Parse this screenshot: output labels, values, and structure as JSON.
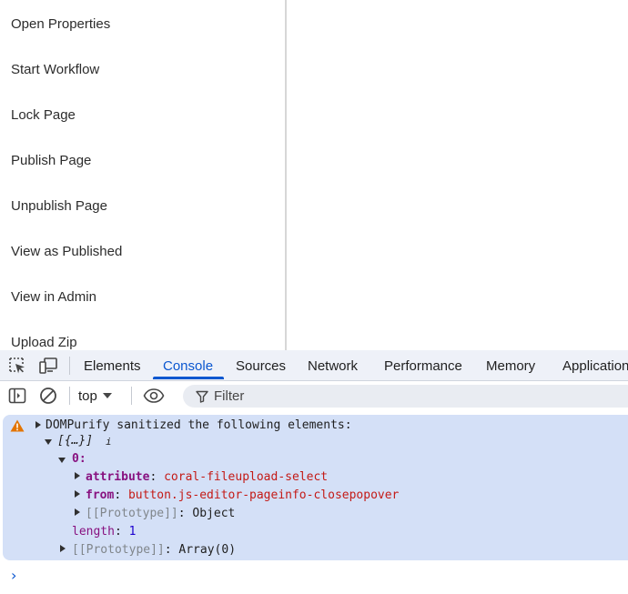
{
  "menu": {
    "items": [
      "Open Properties",
      "Start Workflow",
      "Lock Page",
      "Publish Page",
      "Unpublish Page",
      "View as Published",
      "View in Admin",
      "Upload Zip"
    ]
  },
  "devtools": {
    "tabs": [
      "Elements",
      "Console",
      "Sources",
      "Network",
      "Performance",
      "Memory",
      "Application"
    ],
    "active_tab": "Console",
    "toolbar": {
      "context": "top",
      "filter_placeholder": "Filter"
    },
    "console": {
      "warning_message": "DOMPurify sanitized the following elements:",
      "array_summary": "[{…}]",
      "info_marker": "i",
      "item_index": "0:",
      "attribute_key": "attribute",
      "attribute_value": "coral-fileupload-select",
      "from_key": "from",
      "from_value": "button.js-editor-pageinfo-closepopover",
      "proto_key": "[[Prototype]]",
      "proto_object_value": "Object",
      "length_key": "length",
      "length_value": "1",
      "proto_array_value": "Array(0)",
      "colon": ":",
      "prompt": "›"
    },
    "colors": {
      "accent": "#0b57d0",
      "warning_bg": "#d4e0f7",
      "warning_icon": "#e37400"
    }
  }
}
